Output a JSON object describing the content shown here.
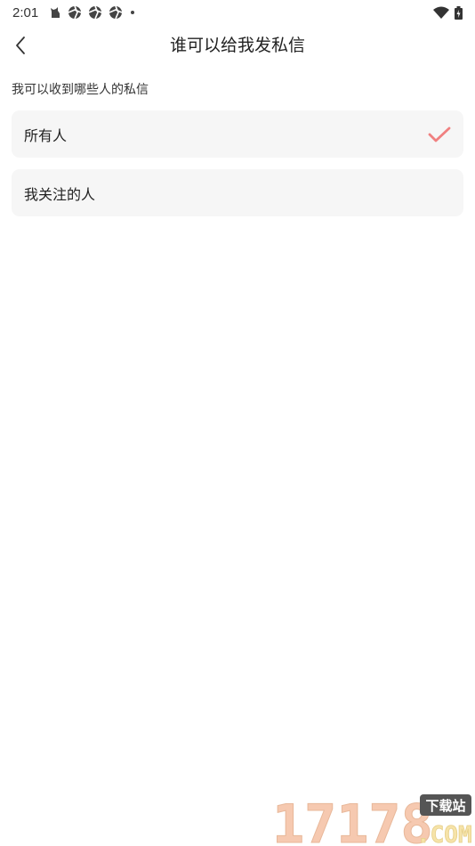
{
  "status_bar": {
    "time": "2:01"
  },
  "header": {
    "title": "谁可以给我发私信"
  },
  "section": {
    "label": "我可以收到哪些人的私信"
  },
  "options": [
    {
      "label": "所有人",
      "selected": true
    },
    {
      "label": "我关注的人",
      "selected": false
    }
  ],
  "colors": {
    "check": "#f08080",
    "option_bg": "#f6f6f6"
  },
  "watermark": {
    "number": "17178",
    "tag": "下载站",
    "domain": ".COM"
  }
}
